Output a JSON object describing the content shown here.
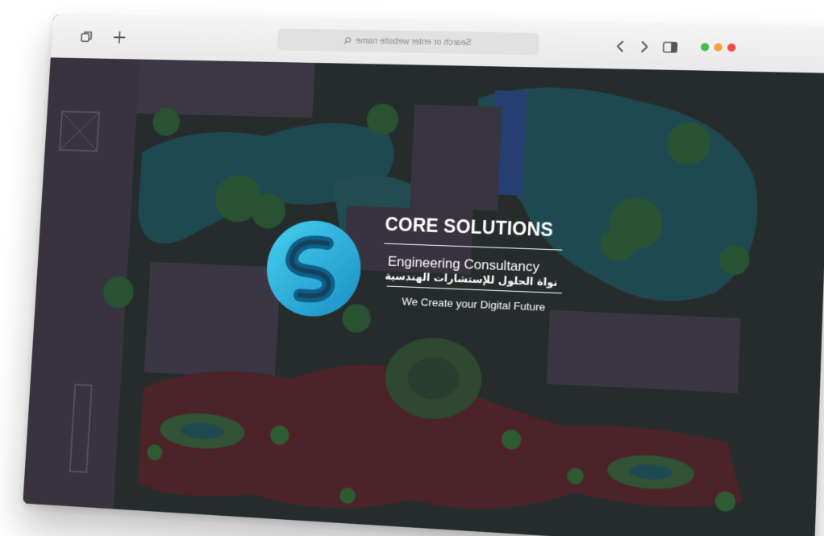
{
  "browser": {
    "address_placeholder": "Search or enter website name",
    "icons": [
      "tabs-icon",
      "new-tab-icon",
      "search-icon",
      "back-icon",
      "forward-icon",
      "sidebar-icon"
    ],
    "traffic_lights": [
      "#3cc04a",
      "#f3a23a",
      "#ee4a4a"
    ]
  },
  "hero": {
    "title": "CORE SOLUTIONS",
    "subtitle": "Engineering Consultancy",
    "arabic_name": "نواة الحلول للإستشارات الهندسية",
    "tagline": "We Create your Digital Future"
  },
  "colors": {
    "logo_primary": "#2bb5e0",
    "logo_dark": "#0f5f88",
    "overlay": "#1e1a28",
    "water": "#1f6b6e",
    "foliage": "#2f7a3a",
    "path": "#7a2d2a"
  }
}
